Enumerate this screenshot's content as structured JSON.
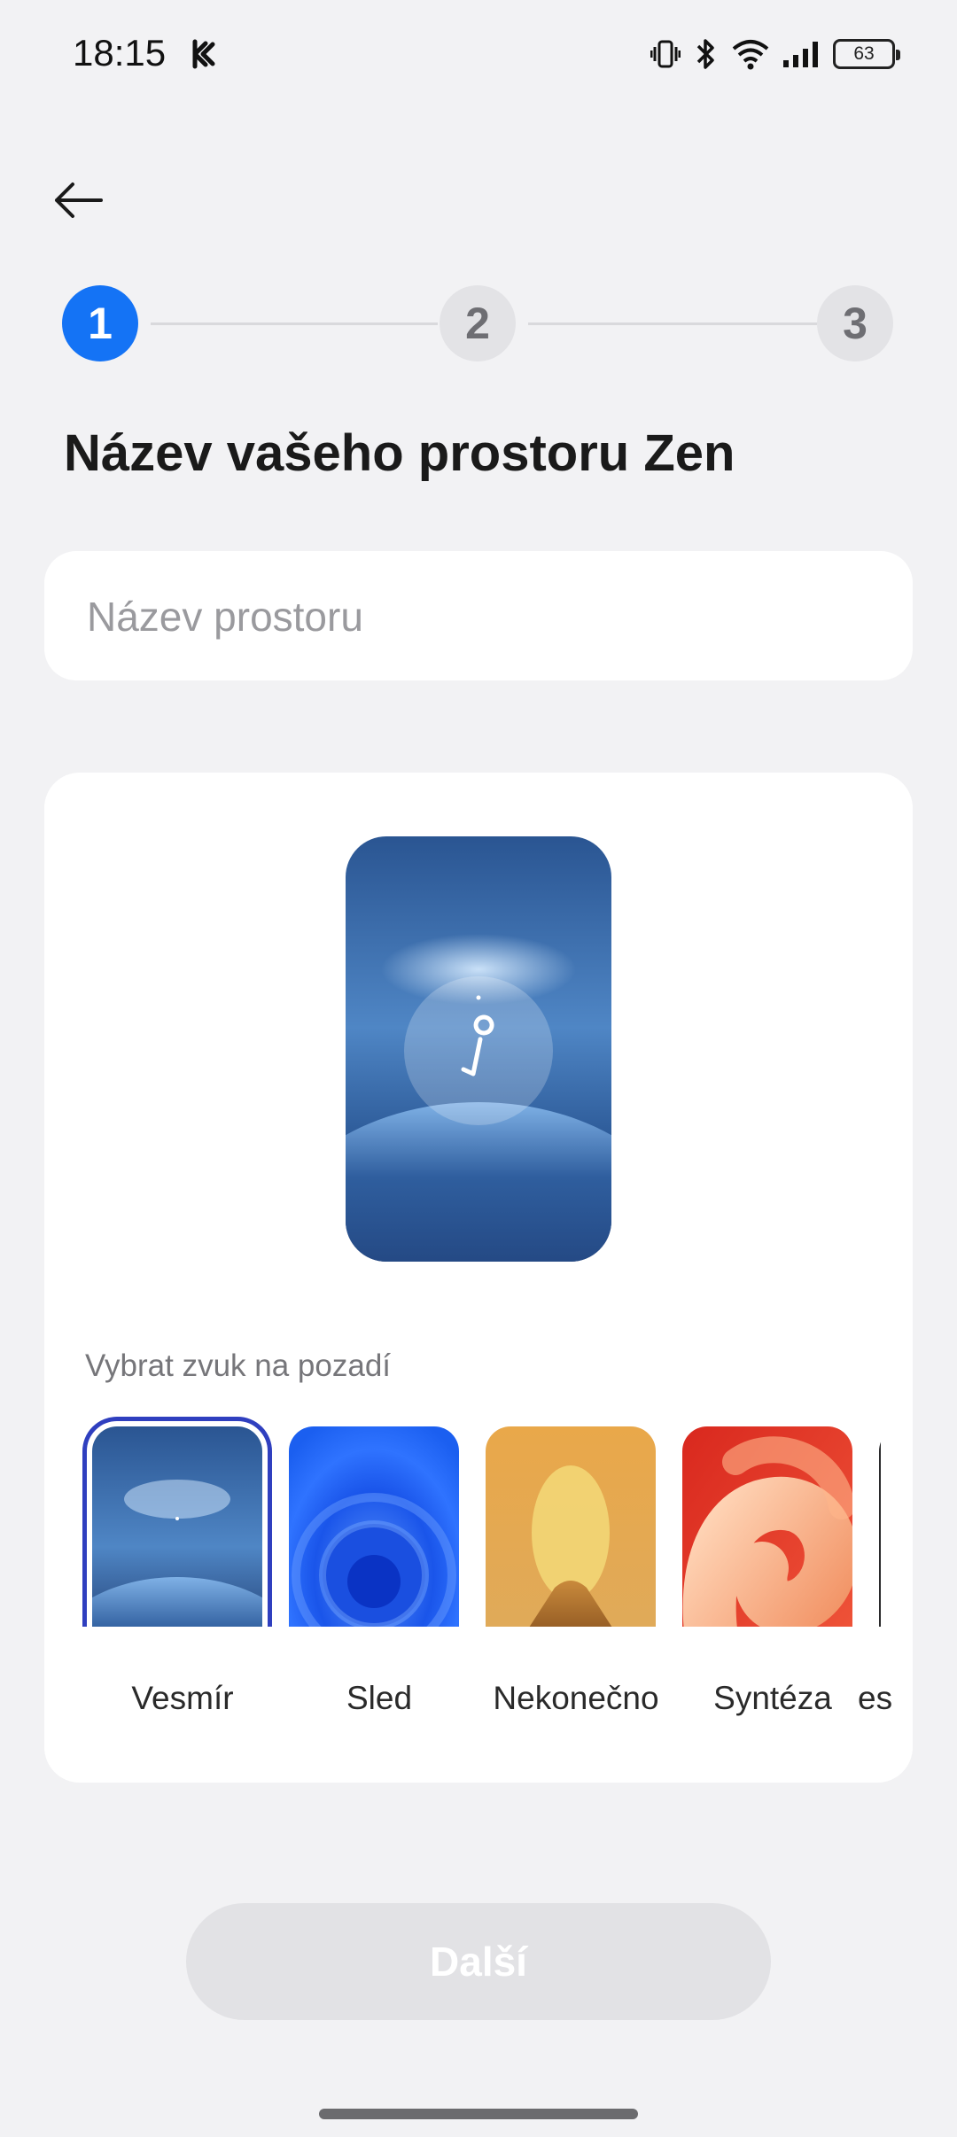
{
  "status_bar": {
    "time": "18:15",
    "battery": "63"
  },
  "stepper": {
    "steps": [
      "1",
      "2",
      "3"
    ],
    "current": 1
  },
  "title": "Název vašeho prostoru Zen",
  "name_input": {
    "placeholder": "Název prostoru",
    "value": ""
  },
  "sound": {
    "label": "Vybrat zvuk na pozadí",
    "selected": "Vesmír",
    "options": [
      "Vesmír",
      "Sled",
      "Nekonečno",
      "Syntéza",
      "es"
    ]
  },
  "next_button": {
    "label": "Další",
    "enabled": false
  },
  "colors": {
    "accent": "#1473f5",
    "selection": "#2f3fbf",
    "disabled": "#e2e2e5",
    "background": "#f2f2f4"
  }
}
